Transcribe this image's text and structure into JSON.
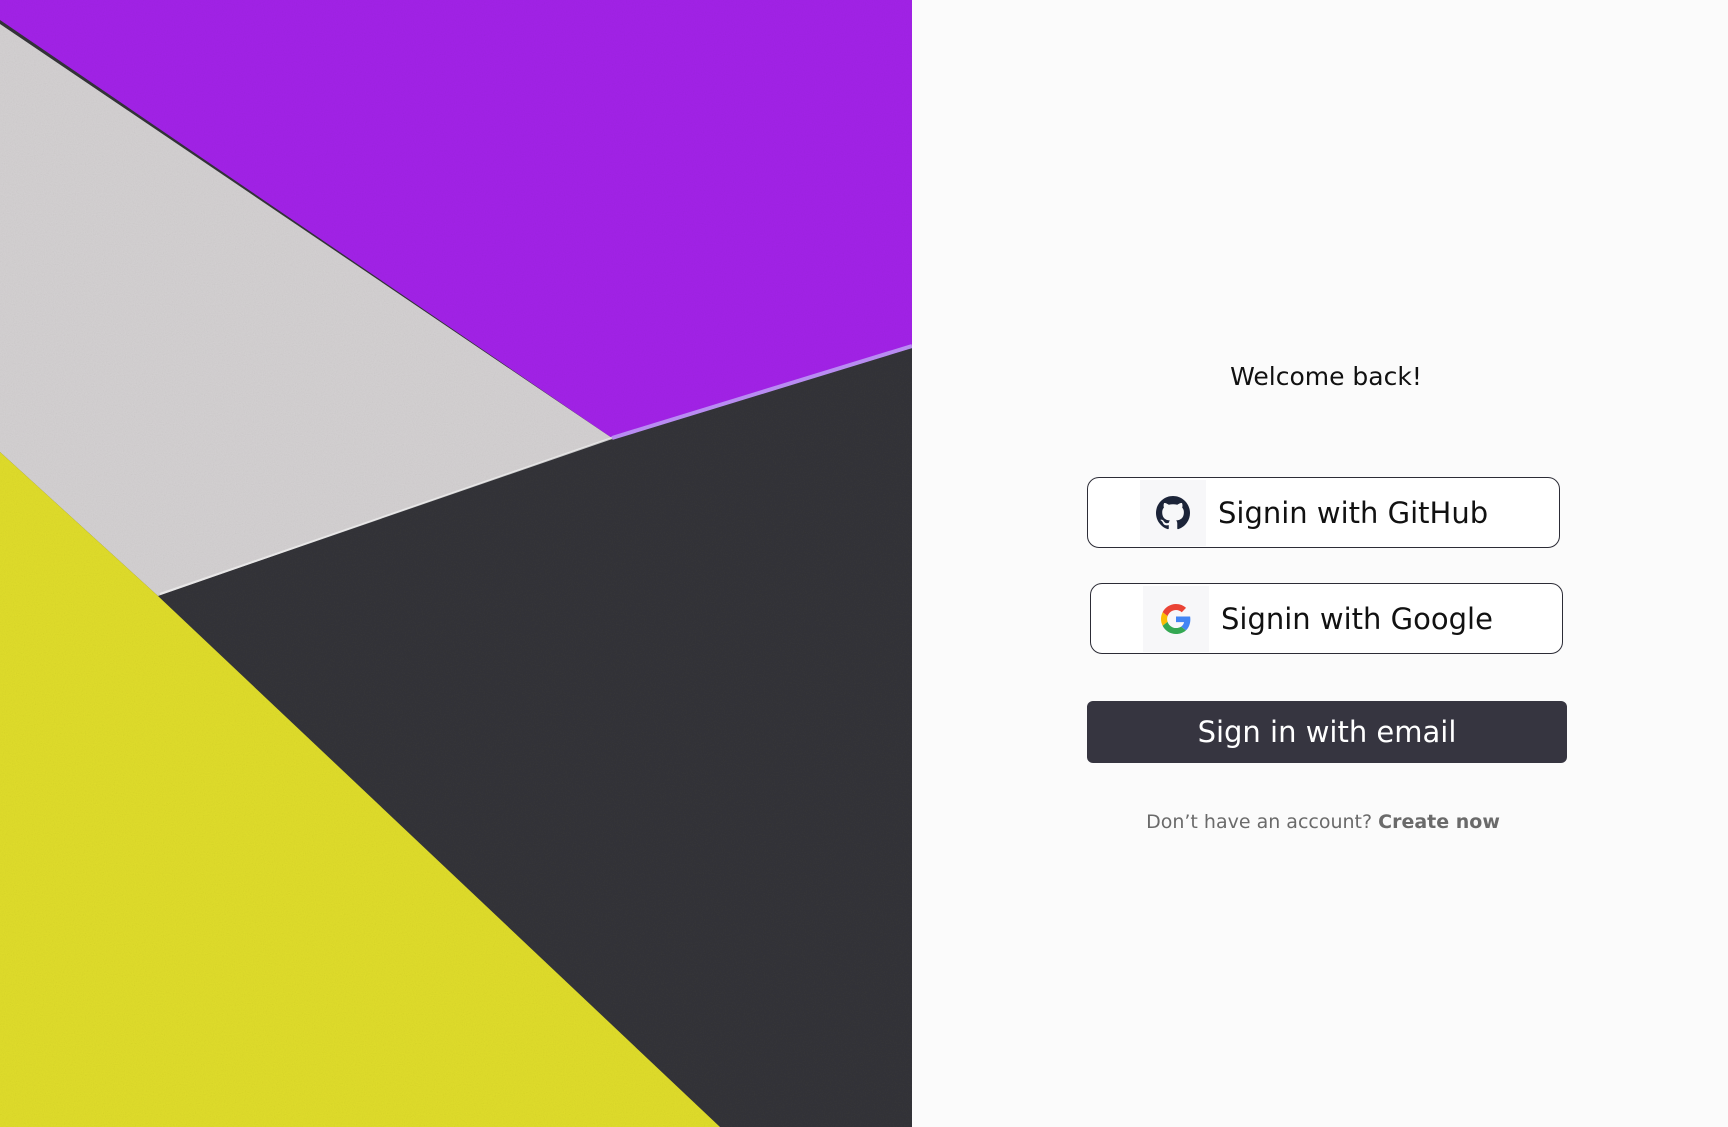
{
  "login": {
    "welcome_text": "Welcome back!",
    "github_label": "Signin with GitHub",
    "google_label": "Signin with Google",
    "email_label": "Sign in with email",
    "signup_prompt": "Don’t have an account?",
    "signup_link": "Create now"
  },
  "icons": {
    "github": "github-icon",
    "google": "google-icon"
  },
  "colors": {
    "hero_purple": "#a323e8",
    "hero_gray": "#d4d1d2",
    "hero_dark": "#343438",
    "hero_yellow": "#e0dd2a",
    "email_button": "#363540",
    "panel_background": "#fbfbfb"
  }
}
